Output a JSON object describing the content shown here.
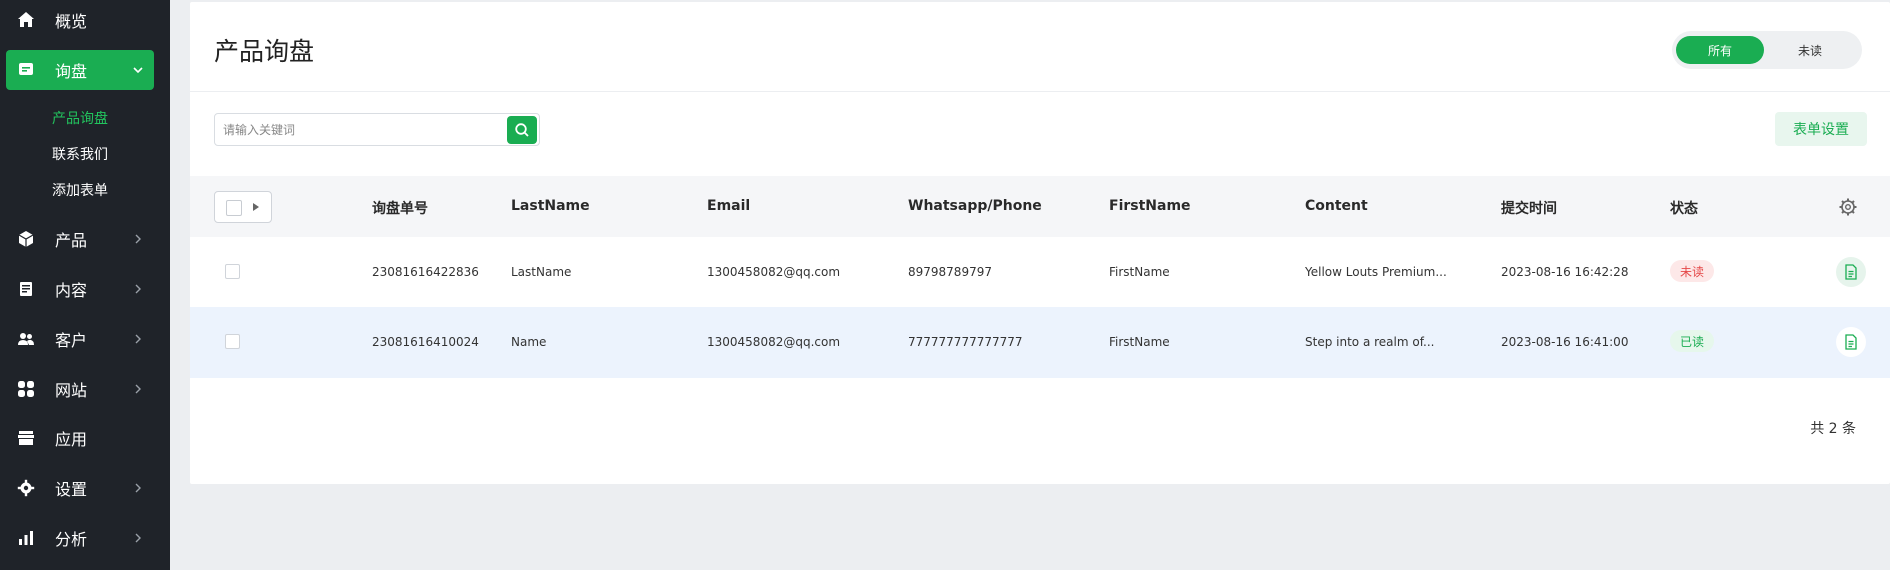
{
  "sidebar": {
    "items": [
      {
        "label": "概览",
        "icon": "home-icon"
      },
      {
        "label": "询盘",
        "icon": "message-icon"
      },
      {
        "label": "产品",
        "icon": "box-icon"
      },
      {
        "label": "内容",
        "icon": "document-icon"
      },
      {
        "label": "客户",
        "icon": "users-icon"
      },
      {
        "label": "网站",
        "icon": "grid-icon"
      },
      {
        "label": "应用",
        "icon": "store-icon"
      },
      {
        "label": "设置",
        "icon": "gear-icon"
      },
      {
        "label": "分析",
        "icon": "bar-chart-icon"
      }
    ],
    "sub_items": [
      "产品询盘",
      "联系我们",
      "添加表单"
    ]
  },
  "page": {
    "title": "产品询盘",
    "filter_all": "所有",
    "filter_unread": "未读",
    "search_placeholder": "请输入关键词",
    "form_settings": "表单设置"
  },
  "table": {
    "headers": {
      "id": "询盘单号",
      "lastname": "LastName",
      "email": "Email",
      "phone": "Whatsapp/Phone",
      "firstname": "FirstName",
      "content": "Content",
      "time": "提交时间",
      "status": "状态"
    },
    "rows": [
      {
        "id": "23081616422836",
        "lastname": "LastName",
        "email": "1300458082@qq.com",
        "phone": "89798789797",
        "firstname": "FirstName",
        "content": "Yellow Louts Premium...",
        "time": "2023-08-16 16:42:28",
        "status": "未读"
      },
      {
        "id": "23081616410024",
        "lastname": "Name",
        "email": "1300458082@qq.com",
        "phone": "777777777777777",
        "firstname": "FirstName",
        "content": "Step into a realm of...",
        "time": "2023-08-16 16:41:00",
        "status": "已读"
      }
    ],
    "total": "共 2 条"
  },
  "colors": {
    "accent": "#1aad52",
    "sidebar_bg": "#1f2329",
    "unread": "#e54848"
  }
}
